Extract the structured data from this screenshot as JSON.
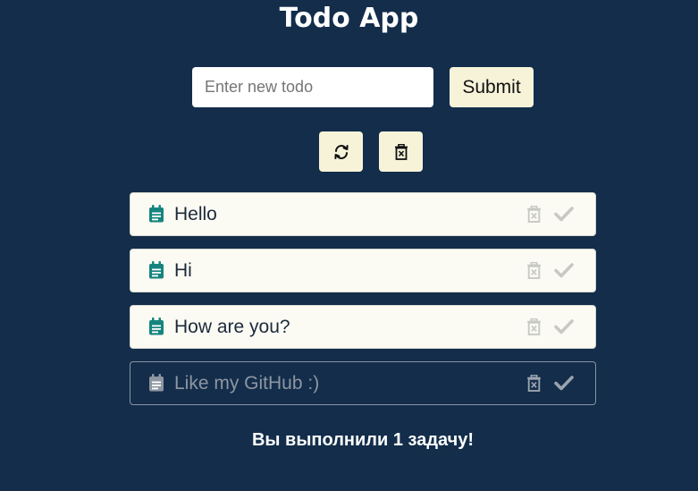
{
  "app": {
    "title": "Todo App"
  },
  "form": {
    "input_placeholder": "Enter new todo",
    "input_value": "",
    "submit_label": "Submit"
  },
  "toolbar": {
    "refresh_icon": "refresh-icon",
    "clear_icon": "trash-x-icon"
  },
  "todos": [
    {
      "text": "Hello",
      "completed": false
    },
    {
      "text": "Hi",
      "completed": false
    },
    {
      "text": "How are you?",
      "completed": false
    },
    {
      "text": "Like my GitHub :)",
      "completed": true
    }
  ],
  "summary": {
    "text": "Вы выполнили 1 задачу!"
  },
  "colors": {
    "background": "#132d4b",
    "button_bg": "#f7f3d9",
    "item_bg": "#fbfbf4",
    "note_icon_active": "#16857e",
    "note_icon_done": "#8e96a2",
    "action_icon_active": "#c9c9c4",
    "action_icon_done": "#9aa3ae"
  }
}
